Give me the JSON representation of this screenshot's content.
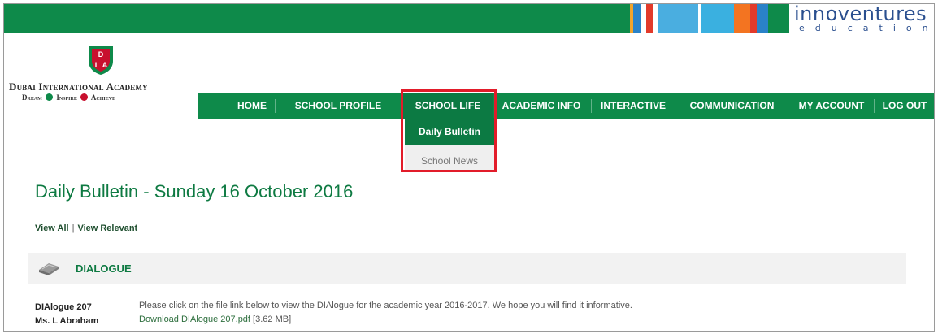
{
  "header": {
    "brand_name": "innoventures",
    "brand_sub": "education",
    "stripe_colors": [
      "#f2a42a",
      "#2a82c8",
      "#ffffff",
      "#e23a2a",
      "#ffffff",
      "#4aaee0",
      "#ffffff",
      "#3ab0e0",
      "#f37421",
      "#e23a2a",
      "#2a82c8"
    ]
  },
  "school": {
    "name": "Dubai International Academy",
    "tagline_1": "Dream",
    "tagline_2": "Inspire",
    "tagline_3": "Achieve",
    "shield_letters": [
      "D",
      "I",
      "A"
    ]
  },
  "nav": {
    "items": [
      "HOME",
      "SCHOOL PROFILE",
      "SCHOOL LIFE",
      "ACADEMIC INFO",
      "INTERACTIVE",
      "COMMUNICATION",
      "MY ACCOUNT",
      "LOG OUT"
    ]
  },
  "dropdown": {
    "items": [
      "Daily Bulletin",
      "School News"
    ]
  },
  "content": {
    "title": "Daily Bulletin - Sunday 16 October 2016",
    "view_all": "View All",
    "pipe": "|",
    "view_relevant": "View Relevant",
    "section_title": "DIALOGUE",
    "entry_name": "DIAlogue 207",
    "entry_author": "Ms. L Abraham",
    "entry_text": "Please click on the file link below to view the DIAlogue for the academic year 2016-2017. We hope you will find it informative.",
    "download_link": "Download DIAlogue 207.pdf",
    "file_size": "[3.62 MB]"
  },
  "colors": {
    "brand_green": "#0e8a4a",
    "highlight_red": "#e21c2a",
    "brand_blue": "#2a4f8f"
  }
}
